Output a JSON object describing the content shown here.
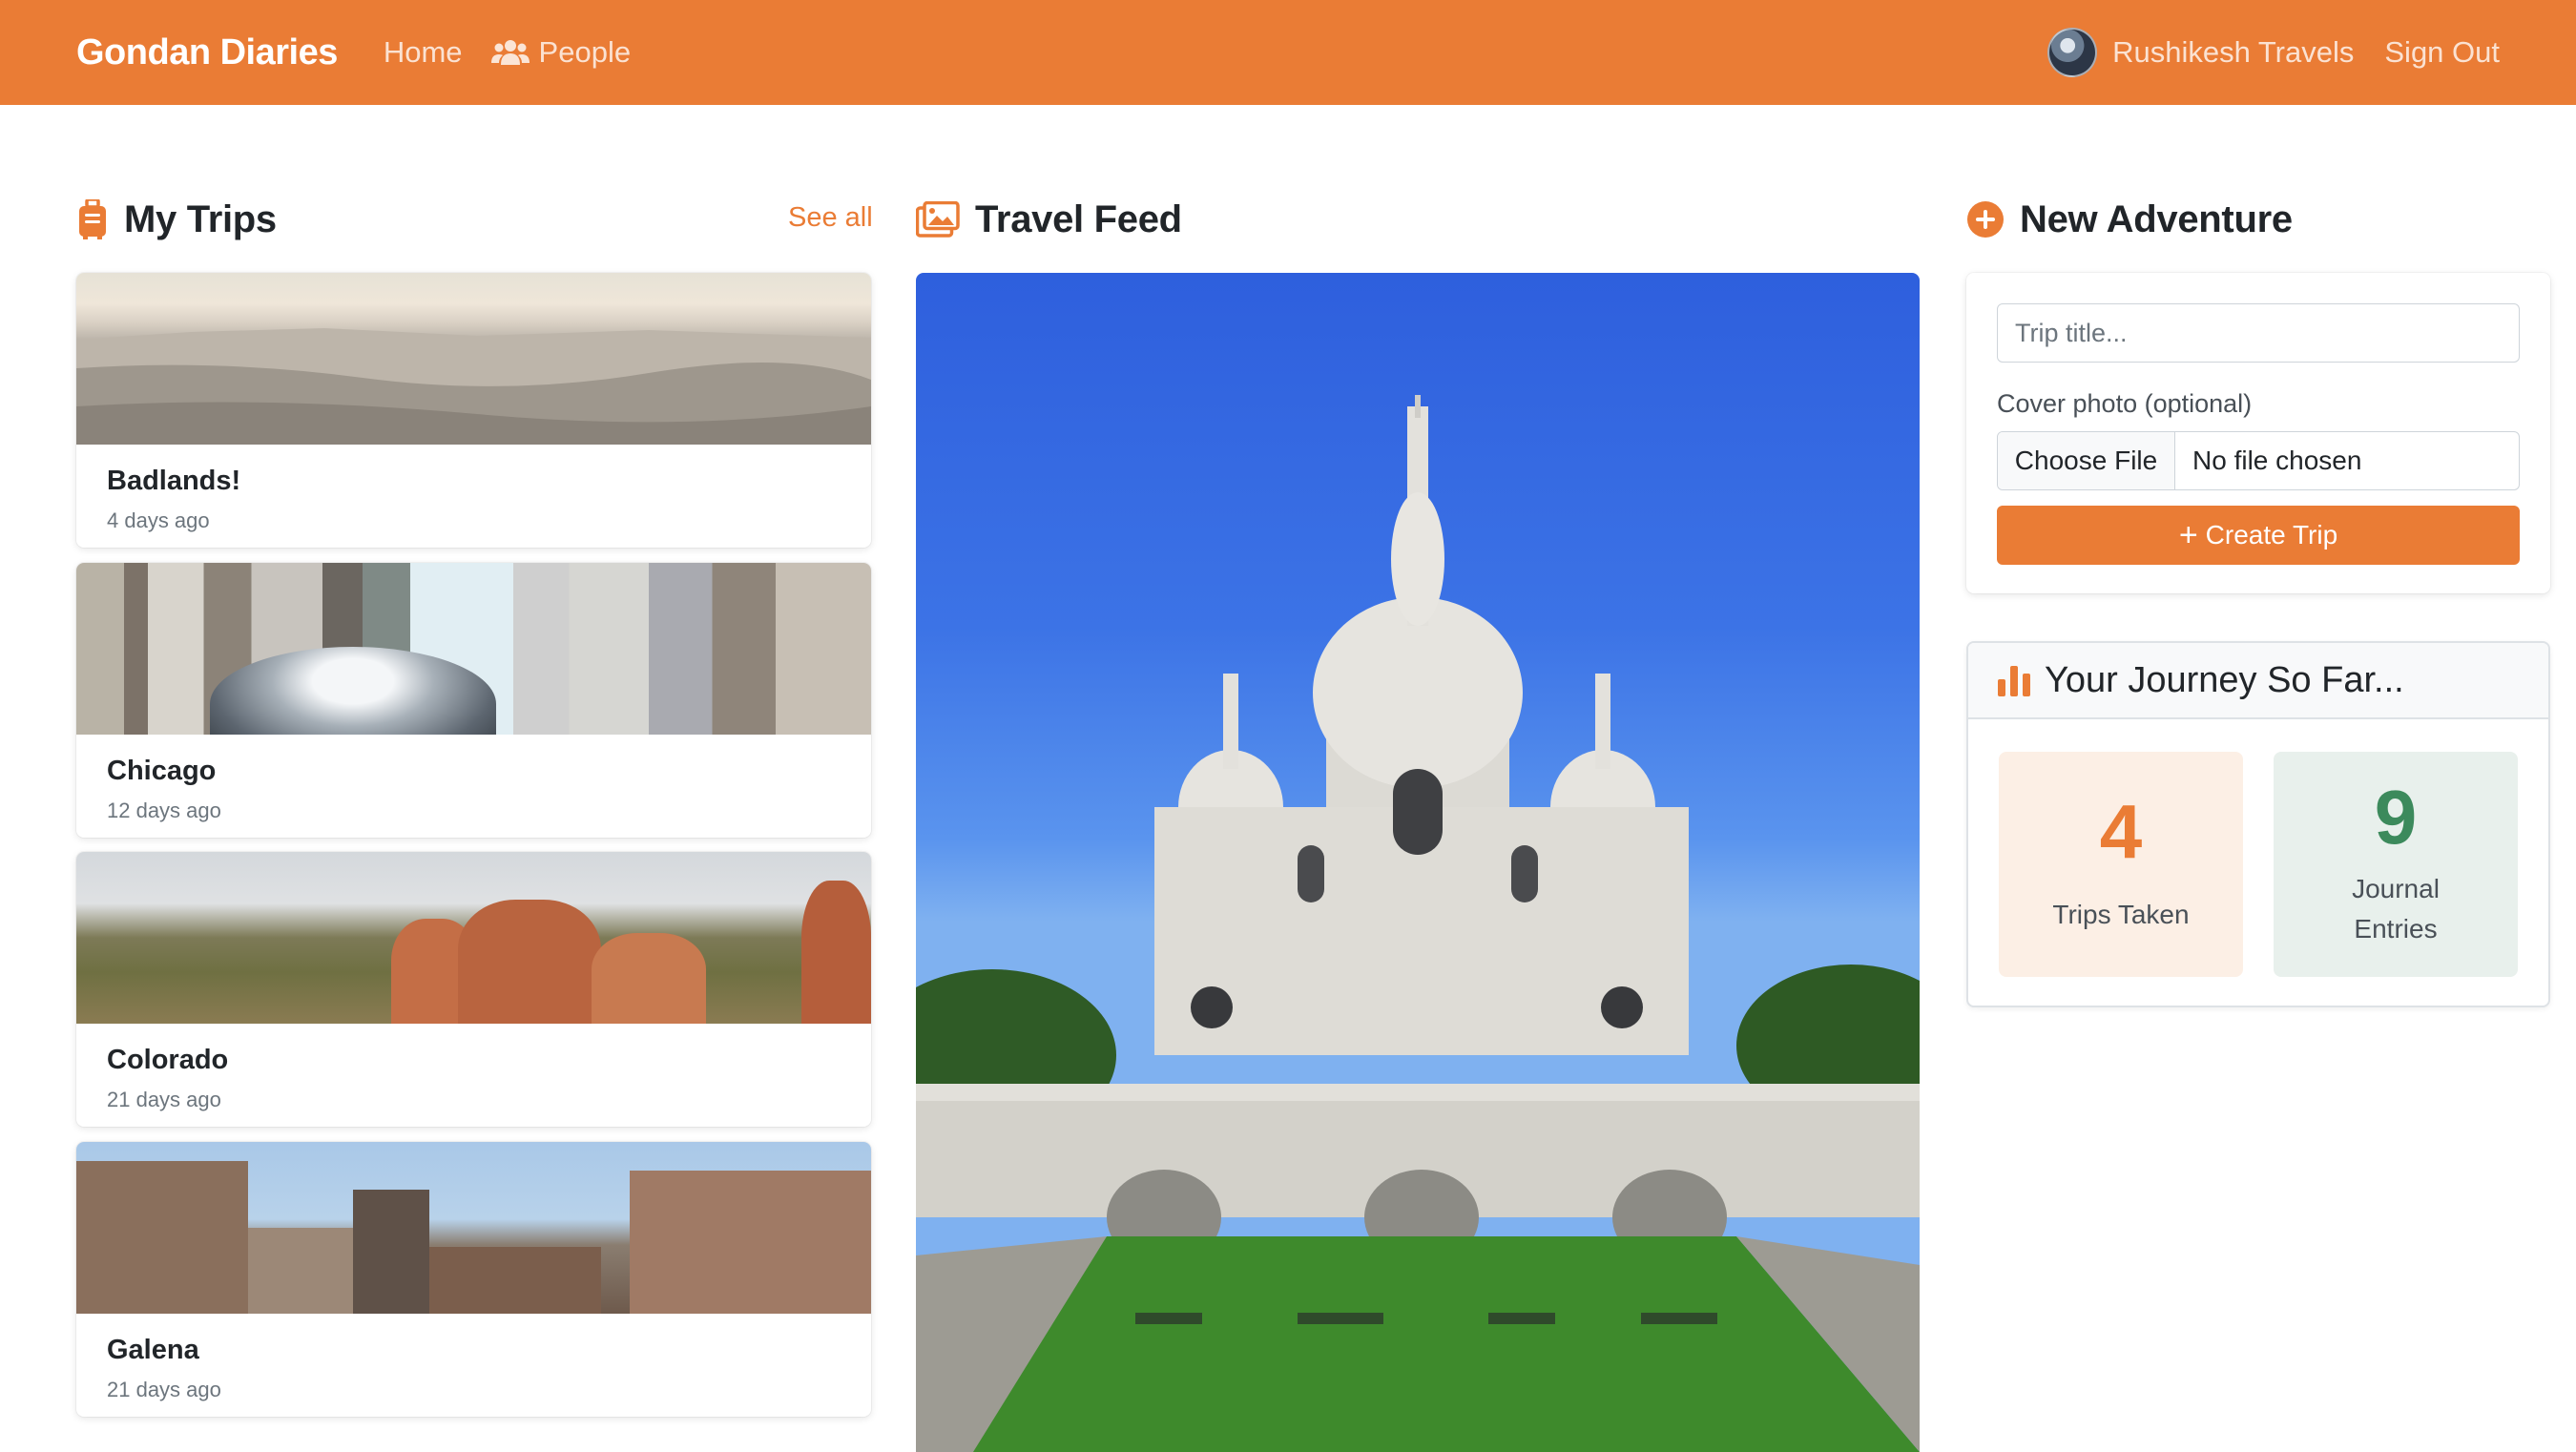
{
  "navbar": {
    "brand": "Gondan Diaries",
    "home": "Home",
    "people": "People",
    "user": "Rushikesh Travels",
    "signout": "Sign Out"
  },
  "my_trips": {
    "title": "My Trips",
    "see_all": "See all",
    "trips": [
      {
        "title": "Badlands!",
        "date": "4 days ago"
      },
      {
        "title": "Chicago",
        "date": "12 days ago"
      },
      {
        "title": "Colorado",
        "date": "21 days ago"
      },
      {
        "title": "Galena",
        "date": "21 days ago"
      }
    ]
  },
  "feed": {
    "title": "Travel Feed"
  },
  "new_adventure": {
    "title": "New Adventure",
    "title_placeholder": "Trip title...",
    "cover_label": "Cover photo (optional)",
    "choose_file": "Choose File",
    "file_status": "No file chosen",
    "create_button": "Create Trip"
  },
  "stats": {
    "title": "Your Journey So Far...",
    "trips_count": "4",
    "trips_label": "Trips Taken",
    "entries_count": "9",
    "entries_label": "Journal Entries"
  },
  "colors": {
    "accent": "#ea7c35",
    "green": "#3c8a5c"
  },
  "icons": {
    "people": "users-icon",
    "trips": "suitcase-icon",
    "feed": "images-icon",
    "adventure": "plus-circle-icon",
    "stats": "bar-chart-icon"
  }
}
